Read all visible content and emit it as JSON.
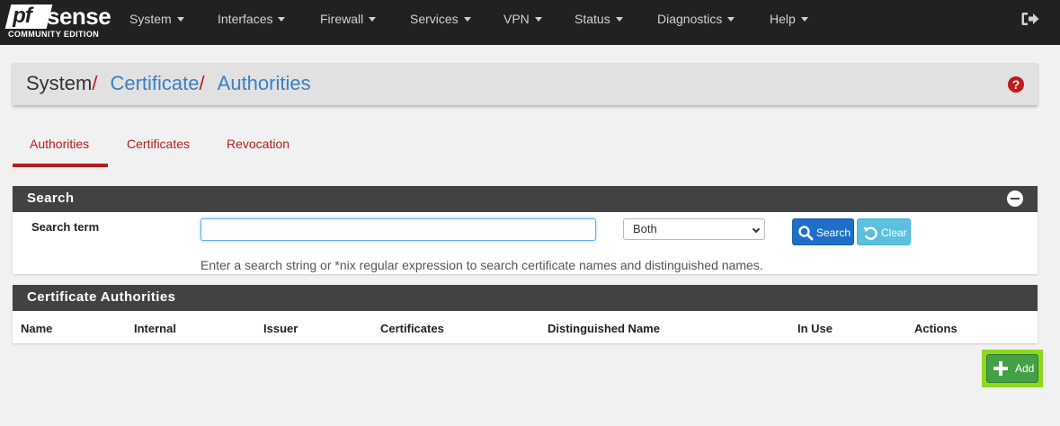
{
  "navbar": {
    "logo_pf": "pf",
    "logo_sense": "sense",
    "logo_edition": "COMMUNITY EDITION",
    "menu": [
      "System",
      "Interfaces",
      "Firewall",
      "Services",
      "VPN",
      "Status",
      "Diagnostics",
      "Help"
    ]
  },
  "breadcrumb": {
    "root": "System",
    "separator": "/",
    "level1": "Certificate",
    "level2": "Authorities"
  },
  "help_icon": "?",
  "tabs": [
    {
      "label": "Authorities",
      "active": true
    },
    {
      "label": "Certificates",
      "active": false
    },
    {
      "label": "Revocation",
      "active": false
    }
  ],
  "search_panel": {
    "title": "Search",
    "term_label": "Search term",
    "term_value": "",
    "scope_value": "Both",
    "search_button": "Search",
    "clear_button": "Clear",
    "hint": "Enter a search string or *nix regular expression to search certificate names and distinguished names."
  },
  "ca_panel": {
    "title": "Certificate Authorities",
    "columns": [
      "Name",
      "Internal",
      "Issuer",
      "Certificates",
      "Distinguished Name",
      "In Use",
      "Actions"
    ]
  },
  "add_button": "Add",
  "colors": {
    "navbar": "#212121",
    "accent_red": "#b71c1c",
    "link_blue": "#3a80c3",
    "panel_head": "#424242",
    "btn_primary": "#1e6fc8",
    "btn_info": "#5bc0de",
    "btn_success": "#43a047",
    "highlight": "#8ed81f"
  }
}
